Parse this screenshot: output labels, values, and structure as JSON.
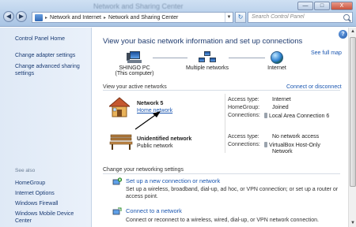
{
  "window": {
    "blurred_title": "Network and Sharing Center",
    "min": "—",
    "max": "□",
    "close": "X"
  },
  "address": {
    "crumbs": [
      "Network and Internet",
      "Network and Sharing Center"
    ],
    "search_placeholder": "Search Control Panel"
  },
  "left": {
    "items": [
      "Control Panel Home",
      "Change adapter settings",
      "Change advanced sharing",
      "settings"
    ],
    "see_also_title": "See also",
    "see_also": [
      "HomeGroup",
      "Internet Options",
      "Windows Firewall",
      "Windows Mobile Device Center"
    ]
  },
  "main": {
    "title": "View your basic network information and set up connections",
    "see_full_map": "See full map",
    "nodes": {
      "pc_name": "SHINGO PC",
      "pc_sub": "(This computer)",
      "multi": "Multiple networks",
      "internet": "Internet"
    },
    "active_label": "View your active networks",
    "connect_disconnect": "Connect or disconnect",
    "networks": [
      {
        "name": "Network  5",
        "type": "Home network",
        "access_key": "Access type:",
        "access_val": "Internet",
        "homegroup_key": "HomeGroup:",
        "homegroup_val": "Joined",
        "conn_key": "Connections:",
        "conn_val": "Local Area Connection 6"
      },
      {
        "name": "Unidentified network",
        "type": "Public network",
        "access_key": "Access type:",
        "access_val": "No network access",
        "conn_key": "Connections:",
        "conn_val_1": "VirtualBox Host-Only",
        "conn_val_2": "Network"
      }
    ],
    "settings_label": "Change your networking settings",
    "tasks": [
      {
        "title": "Set up a new connection or network",
        "desc_1": "Set up a wireless, broadband, dial-up, ad hoc, or VPN connection; or set up a router or",
        "desc_2": "access point."
      },
      {
        "title": "Connect to a network",
        "desc_1": "Connect or reconnect to a wireless, wired, dial-up, or VPN network connection."
      }
    ]
  }
}
